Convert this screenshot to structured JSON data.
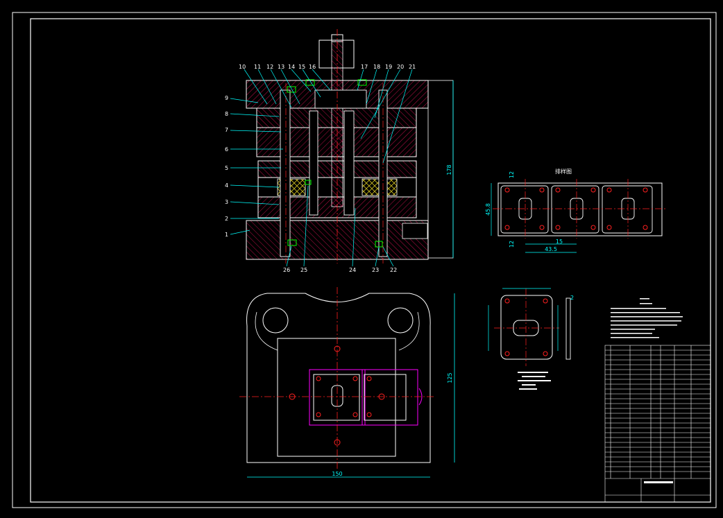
{
  "colors": {
    "background": "#000000",
    "outline": "#ffffff",
    "hatch": "#d01050",
    "center": "#ff2020",
    "leader": "#00ffff",
    "dimension": "#00ffff",
    "balloon": "#00ff00",
    "strip": "#ff00ff"
  },
  "callouts": {
    "top": [
      "10",
      "11",
      "12",
      "13",
      "14",
      "15",
      "16",
      "17",
      "18",
      "19",
      "20",
      "21"
    ],
    "left": [
      "9",
      "8",
      "7",
      "6",
      "5",
      "4",
      "3",
      "2",
      "1"
    ],
    "bottom": [
      "26",
      "25",
      "24",
      "23",
      "22"
    ]
  },
  "dimensions": {
    "section_height": "178",
    "plan_height": "125",
    "plan_width": "150",
    "strip_pitch": "43.5",
    "strip_step": "15",
    "strip_width": "45.8",
    "strip_edge": "12",
    "blank_thickness": "2"
  },
  "strip_title": "排样图",
  "icon": "section-hatch-pattern"
}
